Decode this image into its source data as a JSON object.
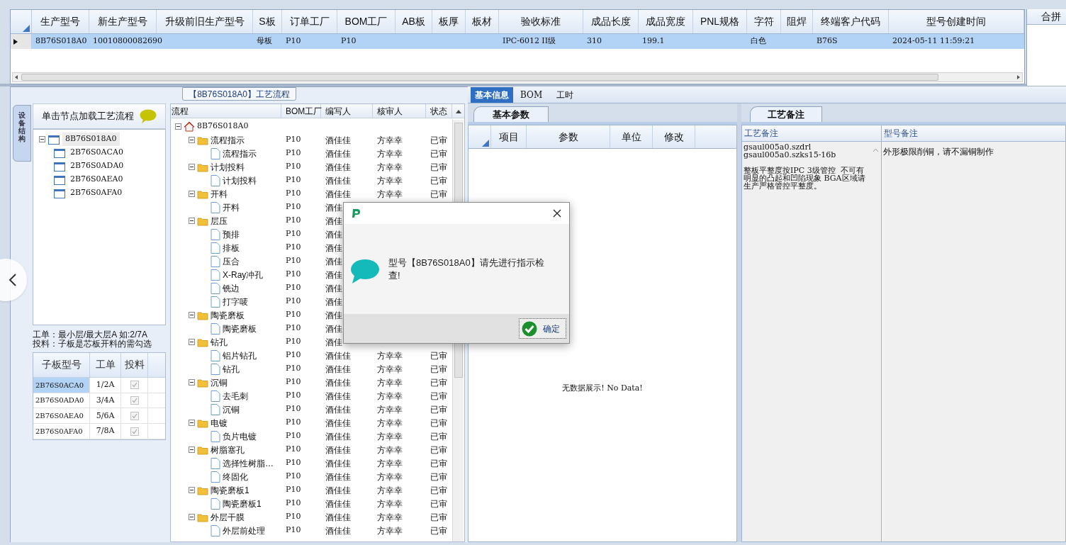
{
  "main_grid": {
    "columns": [
      "生产型号",
      "新生产型号",
      "升级前旧生产型号",
      "S板",
      "订单工厂",
      "BOM工厂",
      "AB板",
      "板厚",
      "板材",
      "验收标准",
      "成品长度",
      "成品宽度",
      "PNL规格",
      "字符",
      "阻焊",
      "终端客户代码",
      "型号创建时间"
    ],
    "rows": [
      {
        "selected": true,
        "cells": {
          "0": "8B76S018A0",
          "1": "10010800082690",
          "3": "母板",
          "4": "P10",
          "5": "P10",
          "9": "IPC-6012 II级",
          "10": "310",
          "11": "199.1",
          "13": "白色",
          "15": "B76S",
          "16": "2024-05-11 11:59:21"
        }
      }
    ]
  },
  "side_panel": {
    "title": "合拼"
  },
  "flow_group": {
    "title": "【8B76S018A0】工艺流程"
  },
  "vertical_tab": {
    "label": "设备结构",
    "selected": true
  },
  "board_tree": {
    "hint": "单击节点加载工艺流程",
    "root": {
      "label": "8B76S018A0",
      "selected": true,
      "children": [
        {
          "label": "2B76S0ACA0"
        },
        {
          "label": "2B76S0ADA0"
        },
        {
          "label": "2B76S0AEA0"
        },
        {
          "label": "2B76S0AFA0"
        }
      ]
    }
  },
  "board_note": "工单：最小层/最大层A 如:2/7A\n投料：子板是芯板开料的需勾选",
  "sub_grid": {
    "columns": [
      "子板型号",
      "工单",
      "投料"
    ],
    "rows": [
      {
        "model": "2B76S0ACA0",
        "order": "1/2A",
        "feed": true,
        "selected": true
      },
      {
        "model": "2B76S0ADA0",
        "order": "3/4A",
        "feed": true,
        "selected": false
      },
      {
        "model": "2B76S0AEA0",
        "order": "5/6A",
        "feed": true,
        "selected": false
      },
      {
        "model": "2B76S0AFA0",
        "order": "7/8A",
        "feed": true,
        "selected": false
      }
    ]
  },
  "flow_tree": {
    "columns": [
      "流程",
      "BOM工厂",
      "编写人",
      "核审人",
      "状态"
    ],
    "root": {
      "label": "8B76S018A0",
      "children": [
        {
          "label": "流程指示",
          "bom": "P10",
          "writer": "酒佳佳",
          "reviewer": "方幸幸",
          "status": "已审",
          "children": [
            {
              "label": "流程指示",
              "bom": "P10",
              "writer": "酒佳佳",
              "reviewer": "方幸幸",
              "status": "已审"
            }
          ]
        },
        {
          "label": "计划投料",
          "bom": "P10",
          "writer": "酒佳佳",
          "reviewer": "方幸幸",
          "status": "已审",
          "children": [
            {
              "label": "计划投料",
              "bom": "P10",
              "writer": "酒佳佳",
              "reviewer": "方幸幸",
              "status": "已审"
            }
          ]
        },
        {
          "label": "开料",
          "bom": "P10",
          "writer": "酒佳佳",
          "reviewer": "方幸幸",
          "status": "已审",
          "children": [
            {
              "label": "开料",
              "bom": "P10",
              "writer": "酒佳"
            }
          ]
        },
        {
          "label": "层压",
          "bom": "P10",
          "writer": "酒佳",
          "children": [
            {
              "label": "预排",
              "bom": "P10",
              "writer": "酒佳"
            },
            {
              "label": "排板",
              "bom": "P10",
              "writer": "酒佳"
            },
            {
              "label": "压合",
              "bom": "P10",
              "writer": "酒佳"
            },
            {
              "label": "X-Ray冲孔",
              "bom": "P10",
              "writer": "酒佳"
            },
            {
              "label": "铣边",
              "bom": "P10",
              "writer": "酒佳"
            },
            {
              "label": "打字唛",
              "bom": "P10",
              "writer": "酒佳"
            }
          ]
        },
        {
          "label": "陶瓷磨板",
          "bom": "P10",
          "writer": "酒佳",
          "children": [
            {
              "label": "陶瓷磨板",
              "bom": "P10",
              "writer": "酒佳"
            }
          ]
        },
        {
          "label": "钻孔",
          "bom": "P10",
          "writer": "酒佳",
          "children": [
            {
              "label": "铝片钻孔",
              "bom": "P10",
              "writer": "酒佳佳",
              "reviewer": "方幸幸",
              "status": "已审"
            },
            {
              "label": "钻孔",
              "bom": "P10",
              "writer": "酒佳佳",
              "reviewer": "方幸幸",
              "status": "已审"
            }
          ]
        },
        {
          "label": "沉铜",
          "bom": "P10",
          "writer": "酒佳佳",
          "reviewer": "方幸幸",
          "status": "已审",
          "children": [
            {
              "label": "去毛刺",
              "bom": "P10",
              "writer": "酒佳佳",
              "reviewer": "方幸幸",
              "status": "已审"
            },
            {
              "label": "沉铜",
              "bom": "P10",
              "writer": "酒佳佳",
              "reviewer": "方幸幸",
              "status": "已审"
            }
          ]
        },
        {
          "label": "电镀",
          "bom": "P10",
          "writer": "酒佳佳",
          "reviewer": "方幸幸",
          "status": "已审",
          "children": [
            {
              "label": "负片电镀",
              "bom": "P10",
              "writer": "酒佳佳",
              "reviewer": "方幸幸",
              "status": "已审"
            }
          ]
        },
        {
          "label": "树脂塞孔",
          "bom": "P10",
          "writer": "酒佳佳",
          "reviewer": "方幸幸",
          "status": "已审",
          "children": [
            {
              "label": "选择性树脂…",
              "bom": "P10",
              "writer": "酒佳佳",
              "reviewer": "方幸幸",
              "status": "已审"
            },
            {
              "label": "终固化",
              "bom": "P10",
              "writer": "酒佳佳",
              "reviewer": "方幸幸",
              "status": "已审"
            }
          ]
        },
        {
          "label": "陶瓷磨板1",
          "bom": "P10",
          "writer": "酒佳佳",
          "reviewer": "方幸幸",
          "status": "已审",
          "children": [
            {
              "label": "陶瓷磨板1",
              "bom": "P10",
              "writer": "酒佳佳",
              "reviewer": "方幸幸",
              "status": "已审"
            }
          ]
        },
        {
          "label": "外层干膜",
          "bom": "P10",
          "writer": "酒佳佳",
          "reviewer": "方幸幸",
          "status": "已审",
          "children": [
            {
              "label": "外层前处理",
              "bom": "P10",
              "writer": "酒佳佳",
              "reviewer": "方幸幸",
              "status": "已审"
            }
          ]
        }
      ]
    }
  },
  "detail_tabs": [
    {
      "label": "基本信息",
      "selected": true
    },
    {
      "label": "BOM",
      "selected": false
    },
    {
      "label": "工时",
      "selected": false
    }
  ],
  "params": {
    "tab": {
      "label": "基本参数",
      "selected": true
    },
    "columns": [
      "项目",
      "参数",
      "单位",
      "修改"
    ],
    "empty_message": "无数据展示! No Data!"
  },
  "notes": {
    "tab": {
      "label": "工艺备注",
      "selected": true
    },
    "columns": [
      "工艺备注",
      "型号备注"
    ],
    "process_note": "gsaul005a0.szdrl\ngsaul005a0.szks15-16b\n\n整板平整度按IPC 3级管控  不可有明显的凸起和凹陷现象 BGA区域请生产严格管控平整度。",
    "model_note": "外形极限削铜，请不漏铜制作"
  },
  "dialog": {
    "message": "型号【8B76S018A0】请先进行指示检查!",
    "ok_button": "确定"
  }
}
